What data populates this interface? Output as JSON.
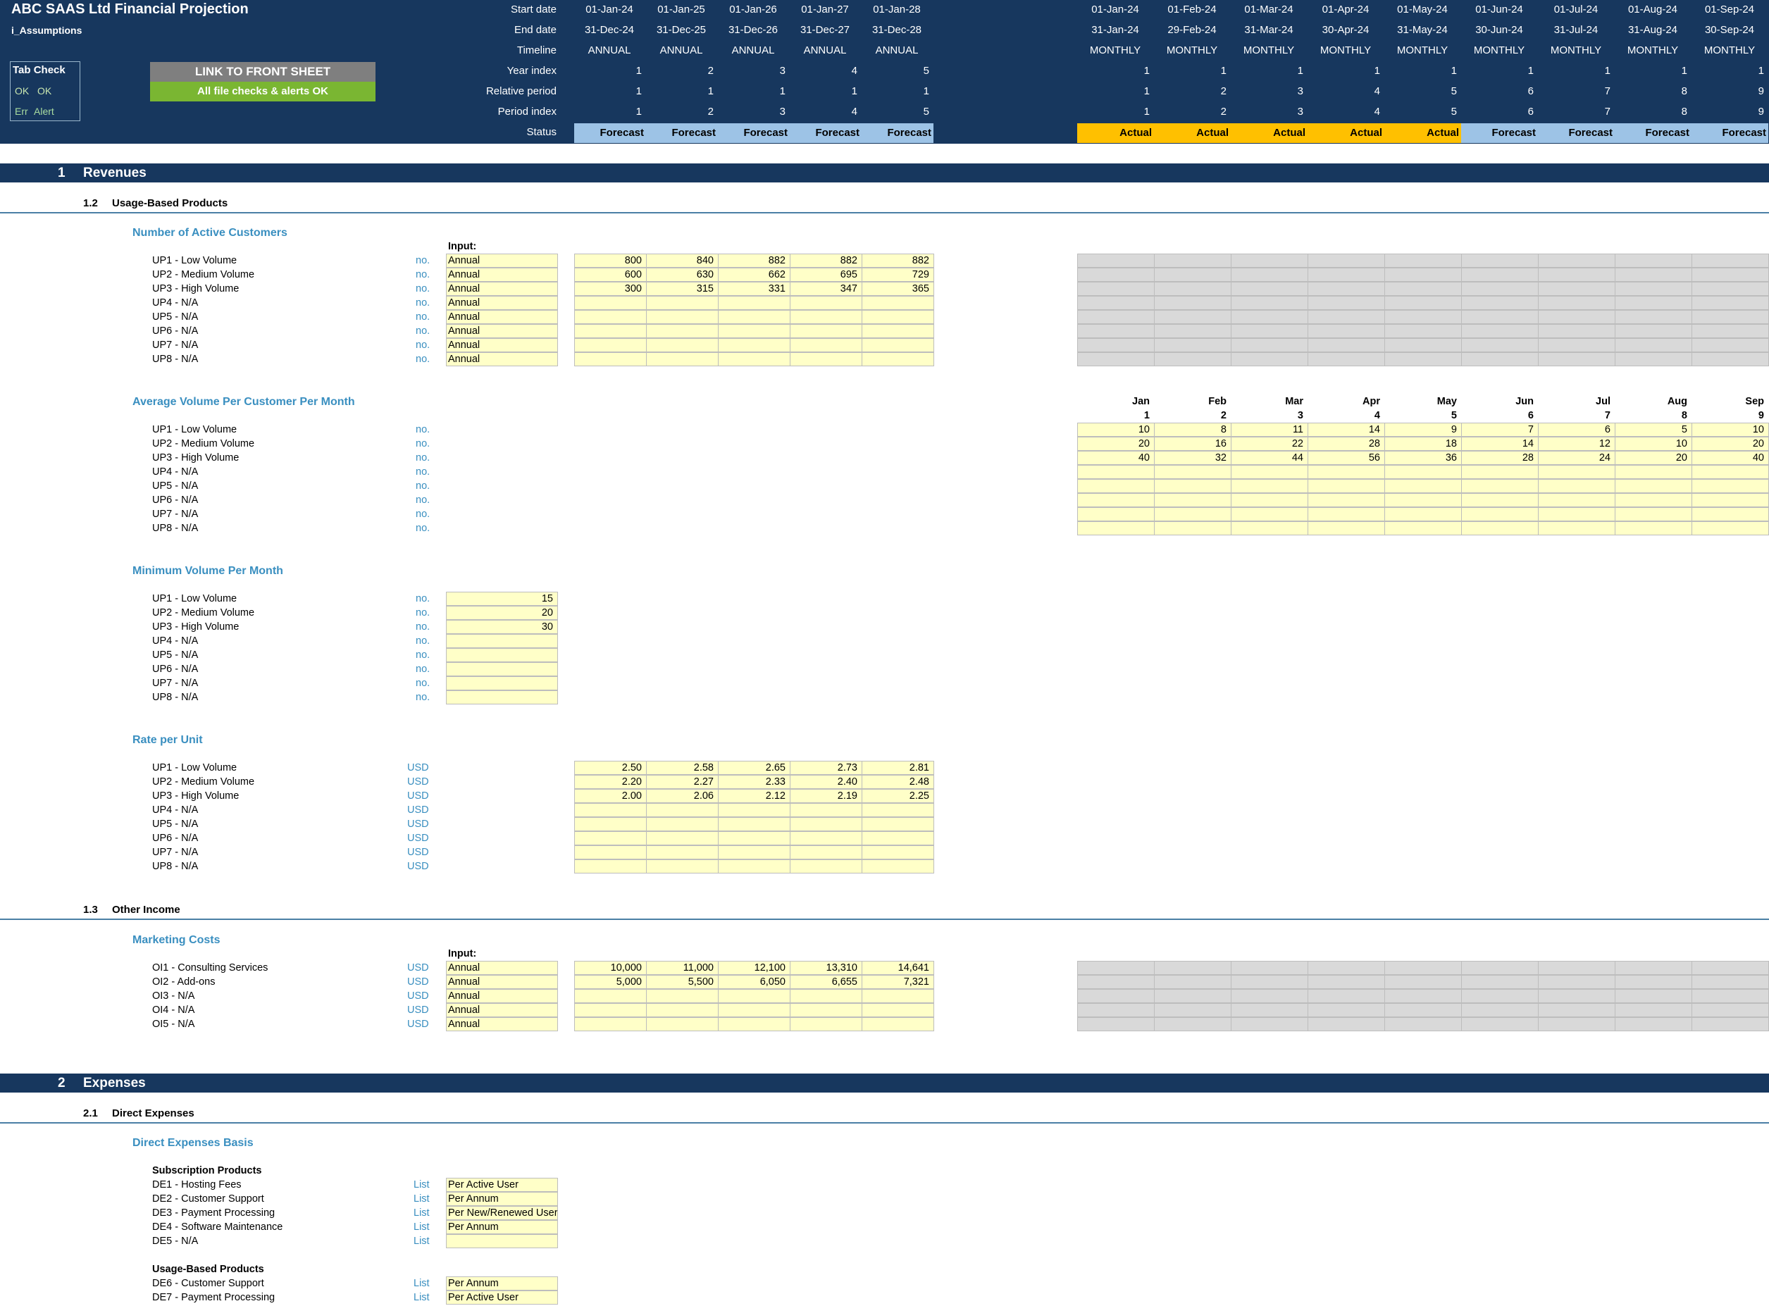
{
  "header": {
    "title": "ABC SAAS Ltd Financial Projection",
    "sheet": "i_Assumptions",
    "row_labels": [
      "Start date",
      "End date",
      "Timeline",
      "Year index",
      "Relative period",
      "Period index",
      "Status"
    ],
    "annual": {
      "start": [
        "01-Jan-24",
        "01-Jan-25",
        "01-Jan-26",
        "01-Jan-27",
        "01-Jan-28"
      ],
      "end": [
        "31-Dec-24",
        "31-Dec-25",
        "31-Dec-26",
        "31-Dec-27",
        "31-Dec-28"
      ],
      "timeline": [
        "ANNUAL",
        "ANNUAL",
        "ANNUAL",
        "ANNUAL",
        "ANNUAL"
      ],
      "year_index": [
        "1",
        "2",
        "3",
        "4",
        "5"
      ],
      "relative": [
        "1",
        "1",
        "1",
        "1",
        "1"
      ],
      "period": [
        "1",
        "2",
        "3",
        "4",
        "5"
      ],
      "status": [
        "Forecast",
        "Forecast",
        "Forecast",
        "Forecast",
        "Forecast"
      ]
    },
    "monthly": {
      "start": [
        "01-Jan-24",
        "01-Feb-24",
        "01-Mar-24",
        "01-Apr-24",
        "01-May-24",
        "01-Jun-24",
        "01-Jul-24",
        "01-Aug-24",
        "01-Sep-24"
      ],
      "end": [
        "31-Jan-24",
        "29-Feb-24",
        "31-Mar-24",
        "30-Apr-24",
        "31-May-24",
        "30-Jun-24",
        "31-Jul-24",
        "31-Aug-24",
        "30-Sep-24"
      ],
      "timeline": [
        "MONTHLY",
        "MONTHLY",
        "MONTHLY",
        "MONTHLY",
        "MONTHLY",
        "MONTHLY",
        "MONTHLY",
        "MONTHLY",
        "MONTHLY"
      ],
      "year_index": [
        "1",
        "1",
        "1",
        "1",
        "1",
        "1",
        "1",
        "1",
        "1"
      ],
      "relative": [
        "1",
        "2",
        "3",
        "4",
        "5",
        "6",
        "7",
        "8",
        "9"
      ],
      "period": [
        "1",
        "2",
        "3",
        "4",
        "5",
        "6",
        "7",
        "8",
        "9"
      ],
      "status": [
        "Actual",
        "Actual",
        "Actual",
        "Actual",
        "Actual",
        "Forecast",
        "Forecast",
        "Forecast",
        "Forecast"
      ]
    },
    "tab_check": {
      "title": "Tab Check",
      "ok_a": "OK",
      "ok_b": "OK",
      "err": "Err",
      "alert": "Alert"
    },
    "link_button": "LINK TO FRONT SHEET",
    "checks_status": "All file checks & alerts OK"
  },
  "colors": {
    "navy": "#17375e",
    "input_yellow": "#ffffc8",
    "actual": "#ffc000",
    "forecast": "#9dc3e6",
    "ok_green": "#7ab632"
  },
  "revenues": {
    "num": "1",
    "title": "Revenues",
    "usage": {
      "num": "1.2",
      "title": "Usage-Based Products",
      "active_customers": {
        "title": "Number of Active Customers",
        "input_label": "Input:",
        "rows": [
          {
            "label": "UP1 - Low Volume",
            "unit": "no.",
            "input": "Annual",
            "values": [
              "800",
              "840",
              "882",
              "882",
              "882"
            ]
          },
          {
            "label": "UP2 - Medium Volume",
            "unit": "no.",
            "input": "Annual",
            "values": [
              "600",
              "630",
              "662",
              "695",
              "729"
            ]
          },
          {
            "label": "UP3 - High Volume",
            "unit": "no.",
            "input": "Annual",
            "values": [
              "300",
              "315",
              "331",
              "347",
              "365"
            ]
          },
          {
            "label": "UP4 - N/A",
            "unit": "no.",
            "input": "Annual",
            "values": [
              "",
              "",
              "",
              "",
              ""
            ]
          },
          {
            "label": "UP5 - N/A",
            "unit": "no.",
            "input": "Annual",
            "values": [
              "",
              "",
              "",
              "",
              ""
            ]
          },
          {
            "label": "UP6 - N/A",
            "unit": "no.",
            "input": "Annual",
            "values": [
              "",
              "",
              "",
              "",
              ""
            ]
          },
          {
            "label": "UP7 - N/A",
            "unit": "no.",
            "input": "Annual",
            "values": [
              "",
              "",
              "",
              "",
              ""
            ]
          },
          {
            "label": "UP8 - N/A",
            "unit": "no.",
            "input": "Annual",
            "values": [
              "",
              "",
              "",
              "",
              ""
            ]
          }
        ]
      },
      "avg_volume": {
        "title": "Average Volume Per Customer Per Month",
        "months": [
          "Jan",
          "Feb",
          "Mar",
          "Apr",
          "May",
          "Jun",
          "Jul",
          "Aug",
          "Sep"
        ],
        "month_nums": [
          "1",
          "2",
          "3",
          "4",
          "5",
          "6",
          "7",
          "8",
          "9"
        ],
        "rows": [
          {
            "label": "UP1 - Low Volume",
            "unit": "no.",
            "values": [
              "10",
              "8",
              "11",
              "14",
              "9",
              "7",
              "6",
              "5",
              "10"
            ]
          },
          {
            "label": "UP2 - Medium Volume",
            "unit": "no.",
            "values": [
              "20",
              "16",
              "22",
              "28",
              "18",
              "14",
              "12",
              "10",
              "20"
            ]
          },
          {
            "label": "UP3 - High Volume",
            "unit": "no.",
            "values": [
              "40",
              "32",
              "44",
              "56",
              "36",
              "28",
              "24",
              "20",
              "40"
            ]
          },
          {
            "label": "UP4 - N/A",
            "unit": "no.",
            "values": [
              "",
              "",
              "",
              "",
              "",
              "",
              "",
              "",
              ""
            ]
          },
          {
            "label": "UP5 - N/A",
            "unit": "no.",
            "values": [
              "",
              "",
              "",
              "",
              "",
              "",
              "",
              "",
              ""
            ]
          },
          {
            "label": "UP6 - N/A",
            "unit": "no.",
            "values": [
              "",
              "",
              "",
              "",
              "",
              "",
              "",
              "",
              ""
            ]
          },
          {
            "label": "UP7 - N/A",
            "unit": "no.",
            "values": [
              "",
              "",
              "",
              "",
              "",
              "",
              "",
              "",
              ""
            ]
          },
          {
            "label": "UP8 - N/A",
            "unit": "no.",
            "values": [
              "",
              "",
              "",
              "",
              "",
              "",
              "",
              "",
              ""
            ]
          }
        ]
      },
      "min_volume": {
        "title": "Minimum Volume Per Month",
        "rows": [
          {
            "label": "UP1 - Low Volume",
            "unit": "no.",
            "value": "15"
          },
          {
            "label": "UP2 - Medium Volume",
            "unit": "no.",
            "value": "20"
          },
          {
            "label": "UP3 - High Volume",
            "unit": "no.",
            "value": "30"
          },
          {
            "label": "UP4 - N/A",
            "unit": "no.",
            "value": ""
          },
          {
            "label": "UP5 - N/A",
            "unit": "no.",
            "value": ""
          },
          {
            "label": "UP6 - N/A",
            "unit": "no.",
            "value": ""
          },
          {
            "label": "UP7 - N/A",
            "unit": "no.",
            "value": ""
          },
          {
            "label": "UP8 - N/A",
            "unit": "no.",
            "value": ""
          }
        ]
      },
      "rate": {
        "title": "Rate per Unit",
        "rows": [
          {
            "label": "UP1 - Low Volume",
            "unit": "USD",
            "values": [
              "2.50",
              "2.58",
              "2.65",
              "2.73",
              "2.81"
            ]
          },
          {
            "label": "UP2 - Medium Volume",
            "unit": "USD",
            "values": [
              "2.20",
              "2.27",
              "2.33",
              "2.40",
              "2.48"
            ]
          },
          {
            "label": "UP3 - High Volume",
            "unit": "USD",
            "values": [
              "2.00",
              "2.06",
              "2.12",
              "2.19",
              "2.25"
            ]
          },
          {
            "label": "UP4 - N/A",
            "unit": "USD",
            "values": [
              "",
              "",
              "",
              "",
              ""
            ]
          },
          {
            "label": "UP5 - N/A",
            "unit": "USD",
            "values": [
              "",
              "",
              "",
              "",
              ""
            ]
          },
          {
            "label": "UP6 - N/A",
            "unit": "USD",
            "values": [
              "",
              "",
              "",
              "",
              ""
            ]
          },
          {
            "label": "UP7 - N/A",
            "unit": "USD",
            "values": [
              "",
              "",
              "",
              "",
              ""
            ]
          },
          {
            "label": "UP8 - N/A",
            "unit": "USD",
            "values": [
              "",
              "",
              "",
              "",
              ""
            ]
          }
        ]
      }
    },
    "other": {
      "num": "1.3",
      "title": "Other Income",
      "marketing": {
        "title": "Marketing Costs",
        "input_label": "Input:",
        "rows": [
          {
            "label": "OI1 - Consulting Services",
            "unit": "USD",
            "input": "Annual",
            "values": [
              "10,000",
              "11,000",
              "12,100",
              "13,310",
              "14,641"
            ]
          },
          {
            "label": "OI2 - Add-ons",
            "unit": "USD",
            "input": "Annual",
            "values": [
              "5,000",
              "5,500",
              "6,050",
              "6,655",
              "7,321"
            ]
          },
          {
            "label": "OI3 - N/A",
            "unit": "USD",
            "input": "Annual",
            "values": [
              "",
              "",
              "",
              "",
              ""
            ]
          },
          {
            "label": "OI4 - N/A",
            "unit": "USD",
            "input": "Annual",
            "values": [
              "",
              "",
              "",
              "",
              ""
            ]
          },
          {
            "label": "OI5 - N/A",
            "unit": "USD",
            "input": "Annual",
            "values": [
              "",
              "",
              "",
              "",
              ""
            ]
          }
        ]
      }
    }
  },
  "expenses": {
    "num": "2",
    "title": "Expenses",
    "direct": {
      "num": "2.1",
      "title": "Direct Expenses",
      "basis_title": "Direct Expenses Basis",
      "groups": [
        {
          "title": "Subscription Products",
          "rows": [
            {
              "label": "DE1 - Hosting Fees",
              "unit": "List",
              "value": "Per Active User"
            },
            {
              "label": "DE2 - Customer Support",
              "unit": "List",
              "value": "Per Annum"
            },
            {
              "label": "DE3 - Payment Processing",
              "unit": "List",
              "value": "Per New/Renewed User"
            },
            {
              "label": "DE4 - Software Maintenance",
              "unit": "List",
              "value": "Per Annum"
            },
            {
              "label": "DE5 - N/A",
              "unit": "List",
              "value": ""
            }
          ]
        },
        {
          "title": "Usage-Based Products",
          "rows": [
            {
              "label": "DE6 - Customer Support",
              "unit": "List",
              "value": "Per Annum"
            },
            {
              "label": "DE7 - Payment Processing",
              "unit": "List",
              "value": "Per Active User"
            }
          ]
        }
      ]
    }
  }
}
